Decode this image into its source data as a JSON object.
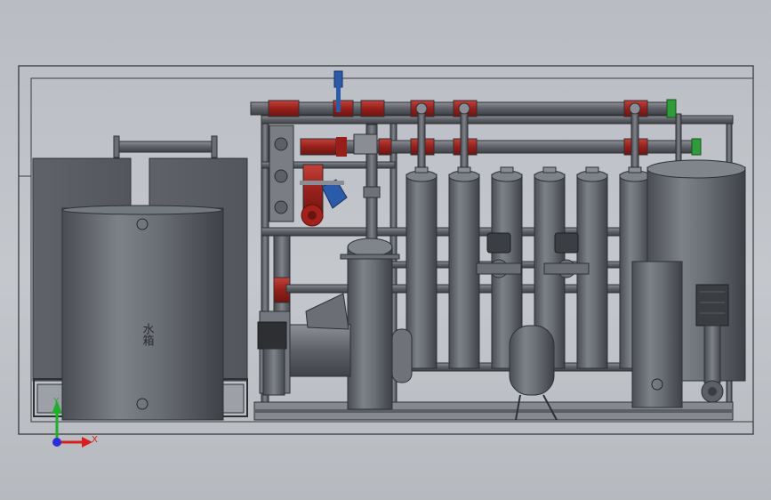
{
  "scene": {
    "type": "CAD assembly front view",
    "tank_label": "水箱"
  },
  "triad": {
    "x_label": "X",
    "y_label": "Y",
    "colors": {
      "x": "#d81e1e",
      "y": "#1fae2e",
      "origin": "#2c2cd8"
    }
  },
  "colors": {
    "background": "#c0c4c9",
    "metal": "#5b5e64",
    "metal_light": "#8b8f96",
    "pipe_red": "#a3201c",
    "valve_blue": "#2b5aa8",
    "flange_green": "#2e9c3a"
  }
}
